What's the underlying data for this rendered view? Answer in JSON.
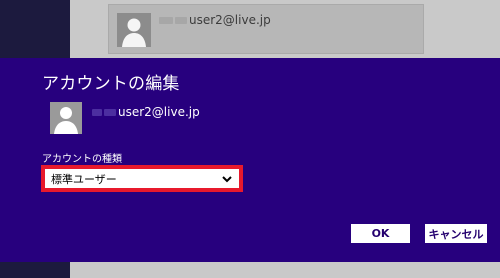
{
  "background": {
    "account": {
      "email": "user2@live.jp"
    }
  },
  "dialog": {
    "title": "アカウントの編集",
    "account_email": "user2@live.jp",
    "account_type_label": "アカウントの種類",
    "account_type_value": "標準ユーザー",
    "ok_label": "OK",
    "cancel_label": "キャンセル"
  },
  "colors": {
    "dialog_bg": "#27007e",
    "highlight": "#e8192c",
    "button_text": "#24006f"
  },
  "icons": [
    "avatar-icon",
    "chevron-down-icon"
  ]
}
